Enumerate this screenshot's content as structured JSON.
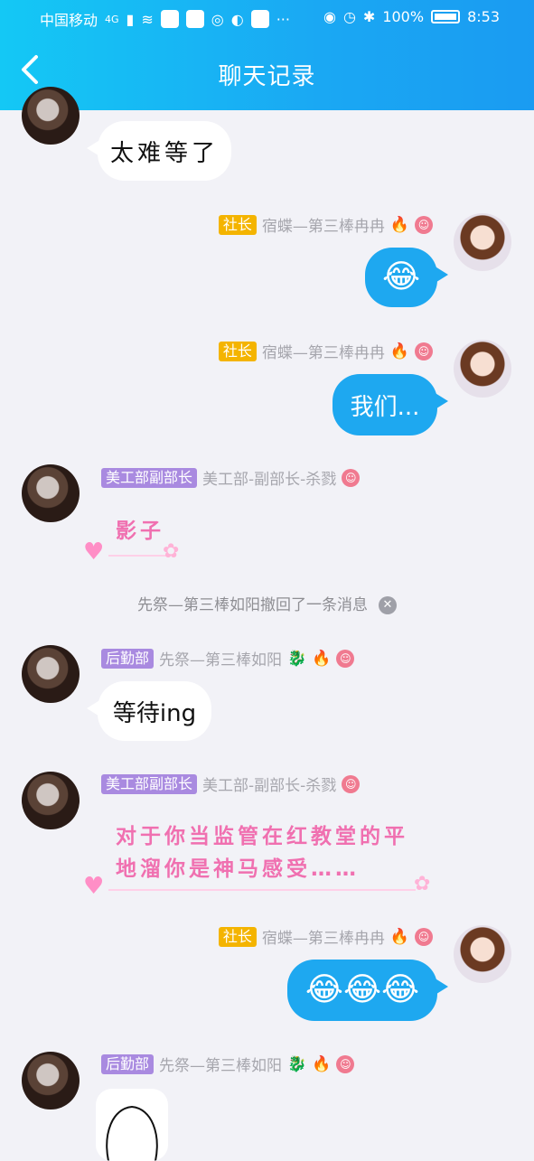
{
  "status": {
    "carrier": "中国移动",
    "network": "4G",
    "more": "···",
    "battery": "100%",
    "time": "8:53"
  },
  "header": {
    "back_icon": "chevron-left-icon",
    "title": "聊天记录"
  },
  "messages": [
    {
      "text": "太难等了"
    },
    {
      "badge": "社长",
      "name": "宿蝶—第三棒冉冉",
      "emoji": "😂"
    },
    {
      "badge": "社长",
      "name": "宿蝶—第三棒冉冉",
      "text": "我们..."
    },
    {
      "badge": "美工部副部长",
      "name": "美工部-副部长-杀戮",
      "text": "影子"
    },
    {
      "badge": "后勤部",
      "name": "先祭—第三棒如阳",
      "text": "等待ing"
    },
    {
      "badge": "美工部副部长",
      "name": "美工部-副部长-杀戮",
      "text_line1": "对于你当监管在红教堂的平",
      "text_line2": "地溜你是神马感受……"
    },
    {
      "badge": "社长",
      "name": "宿蝶—第三棒冉冉",
      "emoji": "😂😂😂"
    },
    {
      "badge": "后勤部",
      "name": "先祭—第三棒如阳"
    }
  ],
  "system": {
    "withdrawn": "先祭—第三棒如阳撤回了一条消息"
  },
  "colors": {
    "header_gradient_start": "#14c8f5",
    "header_gradient_end": "#1a9bf2",
    "bubble_self": "#1ea8f0",
    "badge_leader": "#f4b400",
    "badge_dept": "#a98ae0",
    "pink_text": "#f070b0"
  }
}
